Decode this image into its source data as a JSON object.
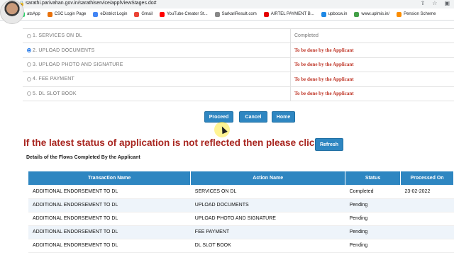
{
  "browser": {
    "url": "sarathi.parivahan.gov.in/sarathiservice/applViewStages.do#",
    "bookmarks": [
      {
        "label": "atsApp",
        "color": "#25d366"
      },
      {
        "label": "CSC Login Page",
        "color": "#e8710a"
      },
      {
        "label": "eDistrict Login",
        "color": "#4285f4"
      },
      {
        "label": "Gmail",
        "color": "#ea4335"
      },
      {
        "label": "YouTube Creator St...",
        "color": "#ff0000"
      },
      {
        "label": "SarkariResult.com",
        "color": "#888888"
      },
      {
        "label": "AIRTEL PAYMENT B...",
        "color": "#e40000"
      },
      {
        "label": "upbocw.in",
        "color": "#1e88e5"
      },
      {
        "label": "www.uplmis.in/",
        "color": "#43a047"
      },
      {
        "label": "Pension Scheme",
        "color": "#fb8c00"
      }
    ]
  },
  "stages": [
    {
      "label": "1.  SERVICES ON DL",
      "status": "Completed",
      "status_type": "done",
      "selected": false
    },
    {
      "label": "2.  UPLOAD DOCUMENTS",
      "status": "To be done by the Applicant",
      "status_type": "todo",
      "selected": true
    },
    {
      "label": "3.  UPLOAD PHOTO AND SIGNATURE",
      "status": "To be done by the Applicant",
      "status_type": "todo",
      "selected": false
    },
    {
      "label": "4.  FEE PAYMENT",
      "status": "To be done by the Applicant",
      "status_type": "todo",
      "selected": false
    },
    {
      "label": "5.  DL SLOT BOOK",
      "status": "To be done by the Applicant",
      "status_type": "todo",
      "selected": false
    }
  ],
  "actions": {
    "proceed": "Proceed",
    "cancel": "Cancel",
    "home": "Home"
  },
  "notice": "If the latest status of application is not reflected then please click on",
  "refresh_label": "Refresh",
  "flows_title": "Details of the Flows Completed By the Applicant",
  "flows": {
    "headers": [
      "Transaction Name",
      "Action Name",
      "Status",
      "Processed On"
    ],
    "rows": [
      [
        "ADDITIONAL ENDORSEMENT TO DL",
        "SERVICES ON DL",
        "Completed",
        "23-02-2022"
      ],
      [
        "ADDITIONAL ENDORSEMENT TO DL",
        "UPLOAD DOCUMENTS",
        "Pending",
        ""
      ],
      [
        "ADDITIONAL ENDORSEMENT TO DL",
        "UPLOAD PHOTO AND SIGNATURE",
        "Pending",
        ""
      ],
      [
        "ADDITIONAL ENDORSEMENT TO DL",
        "FEE PAYMENT",
        "Pending",
        ""
      ],
      [
        "ADDITIONAL ENDORSEMENT TO DL",
        "DL SLOT BOOK",
        "Pending",
        ""
      ]
    ]
  }
}
